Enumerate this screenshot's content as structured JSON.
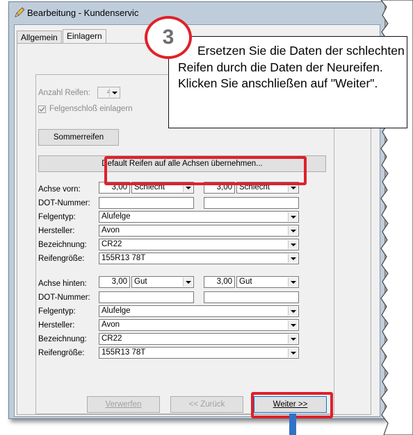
{
  "window": {
    "title": "Bearbeitung - Kundenservic"
  },
  "tabs": [
    {
      "label": "Allgemein"
    },
    {
      "label": "Einlagern"
    }
  ],
  "form": {
    "anzahl_label": "Anzahl Reifen:",
    "anzahl_value": "4",
    "felgenschloss_label": "Felgenschloß einlagern",
    "felgenschloss_checked": true,
    "sommer_button": "Sommerreifen",
    "default_button": "Default Reifen auf alle Achsen übernehmen...",
    "front": {
      "axle_label": "Achse vorn:",
      "dot_label": "DOT-Nummer:",
      "left_depth": "3,00",
      "left_state": "Schlecht",
      "right_depth": "3,00",
      "right_state": "Schlecht",
      "rows": [
        {
          "label": "Felgentyp:",
          "value": "Alufelge"
        },
        {
          "label": "Hersteller:",
          "value": "Avon"
        },
        {
          "label": "Bezeichnung:",
          "value": "CR22"
        },
        {
          "label": "Reifengröße:",
          "value": "155R13 78T"
        }
      ]
    },
    "rear": {
      "axle_label": "Achse hinten:",
      "dot_label": "DOT-Nummer:",
      "left_depth": "3,00",
      "left_state": "Gut",
      "right_depth": "3,00",
      "right_state": "Gut",
      "rows": [
        {
          "label": "Felgentyp:",
          "value": "Alufelge"
        },
        {
          "label": "Hersteller:",
          "value": "Avon"
        },
        {
          "label": "Bezeichnung:",
          "value": "CR22"
        },
        {
          "label": "Reifengröße:",
          "value": "155R13 78T"
        }
      ]
    }
  },
  "buttons": {
    "verwerfen": "Verwerfen",
    "zurueck": "<< Zurück",
    "weiter": "Weiter >>"
  },
  "callout": {
    "step": "3",
    "text": "Ersetzen Sie die Daten der schlechten Reifen durch die Daten der Neureifen. Klicken Sie anschließen auf \"Weiter\"."
  },
  "colors": {
    "highlight": "#e0202a",
    "arrow": "#2f73c4",
    "title_bar": "#bfcddb"
  }
}
